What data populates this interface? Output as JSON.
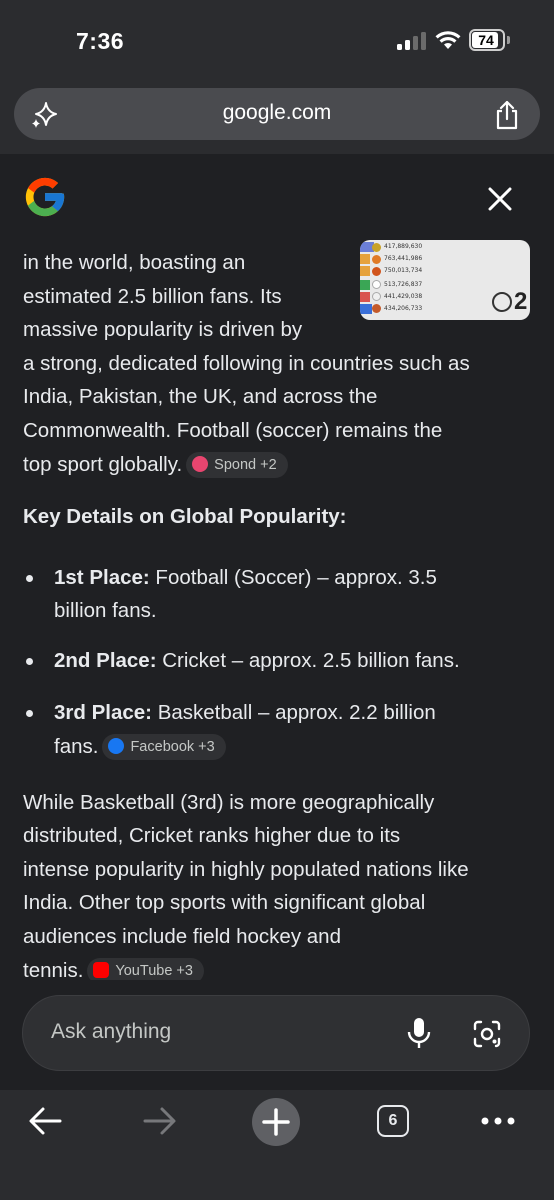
{
  "status_bar": {
    "time": "7:36",
    "battery": "74"
  },
  "url_bar": {
    "url": "google.com"
  },
  "answer": {
    "lines_intro": [
      "in the world, boasting an",
      "estimated 2.5 billion fans. Its",
      "massive popularity is driven by",
      "a strong, dedicated following in countries such as",
      "India, Pakistan, the UK, and across the",
      "Commonwealth. Football (soccer) remains the",
      "top sport globally."
    ],
    "chip_spond": "Spond +2",
    "heading": "Key Details on Global Popularity:",
    "bullets": [
      {
        "label": "1st Place:",
        "line1": " Football (Soccer) – approx. 3.5",
        "line2": "billion fans."
      },
      {
        "label": "2nd Place:",
        "line1": " Cricket – approx. 2.5 billion fans."
      },
      {
        "label": "3rd Place:",
        "line1": " Basketball – approx. 2.2 billion",
        "line2": "fans."
      }
    ],
    "chip_facebook": "Facebook +3",
    "lines_outro": [
      "While Basketball (3rd) is more geographically",
      "distributed, Cricket ranks higher due to its",
      "intense popularity in highly populated nations like",
      "India. Other top sports with significant global",
      "audiences include field hockey and",
      "tennis."
    ],
    "chip_youtube": "YouTube +3",
    "thumbnail": {
      "rows": [
        "417,889,630",
        "763,441,986",
        "750,013,734",
        "513,726,837",
        "441,429,038",
        "434,206,733"
      ],
      "badge": "2"
    }
  },
  "ask_bar": {
    "placeholder": "Ask anything"
  },
  "toolbar": {
    "tab_count": "6"
  },
  "colors": {
    "background": "#1f2023",
    "chrome": "#2b2c2f",
    "text": "#e8eaed"
  }
}
